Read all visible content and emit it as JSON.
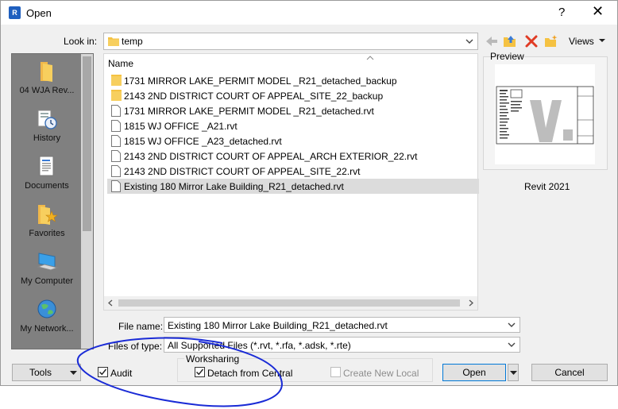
{
  "window": {
    "title": "Open",
    "help": "?",
    "close": "✕",
    "app_icon": "R"
  },
  "look_in": {
    "label": "Look in:",
    "value": "temp"
  },
  "toolbar": {
    "views_label": "Views"
  },
  "places": [
    {
      "label": "04 WJA Rev...",
      "icon": "folder-icon"
    },
    {
      "label": "History",
      "icon": "history-icon"
    },
    {
      "label": "Documents",
      "icon": "documents-icon"
    },
    {
      "label": "Favorites",
      "icon": "favorites-icon"
    },
    {
      "label": "My Computer",
      "icon": "computer-icon"
    },
    {
      "label": "My Network...",
      "icon": "network-icon"
    }
  ],
  "file_list": {
    "column_name": "Name",
    "rows": [
      {
        "name": "1731 MIRROR LAKE_PERMIT MODEL _R21_detached_backup",
        "type": "folder"
      },
      {
        "name": "2143 2ND DISTRICT COURT OF APPEAL_SITE_22_backup",
        "type": "folder"
      },
      {
        "name": "1731 MIRROR LAKE_PERMIT MODEL _R21_detached.rvt",
        "type": "file"
      },
      {
        "name": "1815 WJ OFFICE _A21.rvt",
        "type": "file"
      },
      {
        "name": "1815 WJ OFFICE _A23_detached.rvt",
        "type": "file"
      },
      {
        "name": "2143 2ND DISTRICT COURT OF APPEAL_ARCH EXTERIOR_22.rvt",
        "type": "file"
      },
      {
        "name": "2143 2ND DISTRICT COURT OF APPEAL_SITE_22.rvt",
        "type": "file"
      },
      {
        "name": "Existing 180 Mirror Lake Building_R21_detached.rvt",
        "type": "file",
        "selected": true
      }
    ]
  },
  "preview": {
    "label": "Preview",
    "version": "Revit 2021"
  },
  "file_name": {
    "label": "File name:",
    "value": "Existing 180 Mirror Lake Building_R21_detached.rvt"
  },
  "file_type": {
    "label": "Files of type:",
    "value": "All Supported Files  (*.rvt, *.rfa, *.adsk, *.rte)"
  },
  "bottom": {
    "tools_label": "Tools",
    "audit_label": "Audit",
    "audit_checked": true,
    "worksharing_title": "Worksharing",
    "detach_label": "Detach from Central",
    "detach_checked": true,
    "create_local_label": "Create New Local",
    "create_local_checked": false,
    "open_label": "Open",
    "cancel_label": "Cancel"
  },
  "colors": {
    "annotation": "#1a2bd6",
    "folder": "#f5c242",
    "delete": "#e03b24",
    "places_bg": "#808080"
  }
}
